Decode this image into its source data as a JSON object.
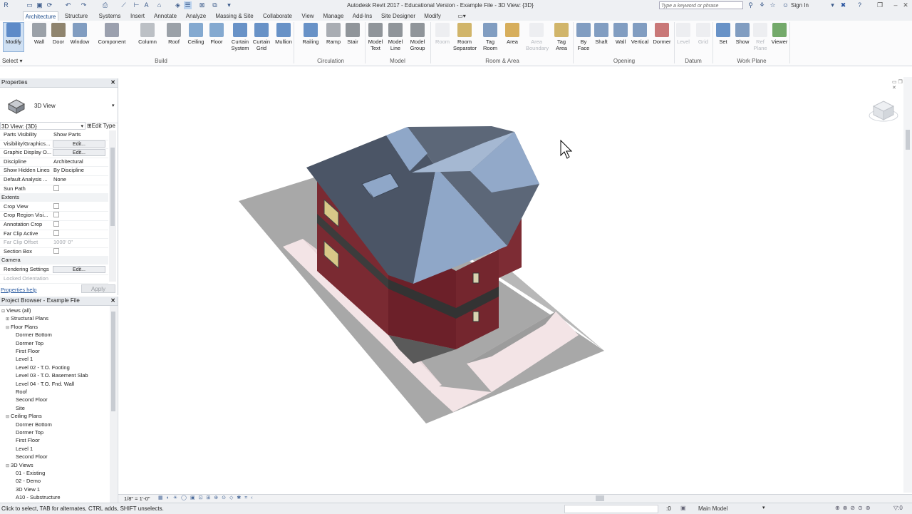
{
  "app": {
    "title": "Autodesk Revit 2017 - Educational Version -    Example File - 3D View: {3D}",
    "search_placeholder": "Type a keyword or phrase",
    "sign_in": "Sign In"
  },
  "tabs": [
    "Architecture",
    "Structure",
    "Systems",
    "Insert",
    "Annotate",
    "Analyze",
    "Massing & Site",
    "Collaborate",
    "View",
    "Manage",
    "Add-Ins",
    "Site Designer",
    "Modify"
  ],
  "ribbon": {
    "select_label": "Select",
    "buttons": [
      {
        "l1": "Modify",
        "l2": ""
      },
      {
        "l1": "Wall",
        "l2": ""
      },
      {
        "l1": "Door",
        "l2": ""
      },
      {
        "l1": "Window",
        "l2": ""
      },
      {
        "l1": "Component",
        "l2": ""
      },
      {
        "l1": "Column",
        "l2": ""
      },
      {
        "l1": "Roof",
        "l2": ""
      },
      {
        "l1": "Ceiling",
        "l2": ""
      },
      {
        "l1": "Floor",
        "l2": ""
      },
      {
        "l1": "Curtain",
        "l2": "System"
      },
      {
        "l1": "Curtain",
        "l2": "Grid"
      },
      {
        "l1": "Mullion",
        "l2": ""
      },
      {
        "l1": "Railing",
        "l2": ""
      },
      {
        "l1": "Ramp",
        "l2": ""
      },
      {
        "l1": "Stair",
        "l2": ""
      },
      {
        "l1": "Model",
        "l2": "Text"
      },
      {
        "l1": "Model",
        "l2": "Line"
      },
      {
        "l1": "Model",
        "l2": "Group"
      },
      {
        "l1": "Room",
        "l2": ""
      },
      {
        "l1": "Room",
        "l2": "Separator"
      },
      {
        "l1": "Tag",
        "l2": "Room"
      },
      {
        "l1": "Area",
        "l2": ""
      },
      {
        "l1": "Area",
        "l2": "Boundary"
      },
      {
        "l1": "Tag",
        "l2": "Area"
      },
      {
        "l1": "By",
        "l2": "Face"
      },
      {
        "l1": "Shaft",
        "l2": ""
      },
      {
        "l1": "Wall",
        "l2": ""
      },
      {
        "l1": "Vertical",
        "l2": ""
      },
      {
        "l1": "Dormer",
        "l2": ""
      },
      {
        "l1": "Level",
        "l2": ""
      },
      {
        "l1": "Grid",
        "l2": ""
      },
      {
        "l1": "Set",
        "l2": ""
      },
      {
        "l1": "Show",
        "l2": ""
      },
      {
        "l1": "Ref",
        "l2": "Plane"
      },
      {
        "l1": "Viewer",
        "l2": ""
      }
    ],
    "panels": [
      "Build",
      "Circulation",
      "Model",
      "Room & Area",
      "Opening",
      "Datum",
      "Work Plane"
    ]
  },
  "properties": {
    "title": "Properties",
    "type_name": "3D View",
    "instance_selector": "3D View: {3D}",
    "edit_type": "Edit Type",
    "rows_graphics": [
      {
        "k": "Parts Visibility",
        "v": "Show Parts",
        "kind": "text"
      },
      {
        "k": "Visibility/Graphics...",
        "v": "Edit...",
        "kind": "btn"
      },
      {
        "k": "Graphic Display O...",
        "v": "Edit...",
        "kind": "btn"
      },
      {
        "k": "Discipline",
        "v": "Architectural",
        "kind": "text"
      },
      {
        "k": "Show Hidden Lines",
        "v": "By Discipline",
        "kind": "text"
      },
      {
        "k": "Default Analysis ...",
        "v": "None",
        "kind": "text"
      },
      {
        "k": "Sun Path",
        "v": "",
        "kind": "cb"
      }
    ],
    "group_extents": "Extents",
    "rows_extents": [
      {
        "k": "Crop View",
        "v": "",
        "kind": "cb"
      },
      {
        "k": "Crop Region Visi...",
        "v": "",
        "kind": "cb"
      },
      {
        "k": "Annotation Crop",
        "v": "",
        "kind": "cb"
      },
      {
        "k": "Far Clip Active",
        "v": "",
        "kind": "cb"
      },
      {
        "k": "Far Clip Offset",
        "v": "1000'  0\"",
        "kind": "dis"
      },
      {
        "k": "Section Box",
        "v": "",
        "kind": "cb"
      }
    ],
    "group_camera": "Camera",
    "rows_camera": [
      {
        "k": "Rendering Settings",
        "v": "Edit...",
        "kind": "btn"
      },
      {
        "k": "Locked Orientation",
        "v": "",
        "kind": "dis"
      }
    ],
    "help_link": "Properties help",
    "apply": "Apply"
  },
  "browser": {
    "title": "Project Browser - Example File",
    "items": [
      {
        "t": "Views (all)",
        "lvl": 0,
        "tg": "⊟"
      },
      {
        "t": "Structural Plans",
        "lvl": 1,
        "tg": "⊞"
      },
      {
        "t": "Floor Plans",
        "lvl": 1,
        "tg": "⊟"
      },
      {
        "t": "Dormer Bottom",
        "lvl": 2,
        "tg": ""
      },
      {
        "t": "Dormer Top",
        "lvl": 2,
        "tg": ""
      },
      {
        "t": "First Floor",
        "lvl": 2,
        "tg": ""
      },
      {
        "t": "Level 1",
        "lvl": 2,
        "tg": ""
      },
      {
        "t": "Level 02 - T.O. Footing",
        "lvl": 2,
        "tg": ""
      },
      {
        "t": "Level 03 - T.O. Basement Slab",
        "lvl": 2,
        "tg": ""
      },
      {
        "t": "Level 04 - T.O. Fnd. Wall",
        "lvl": 2,
        "tg": ""
      },
      {
        "t": "Roof",
        "lvl": 2,
        "tg": ""
      },
      {
        "t": "Second Floor",
        "lvl": 2,
        "tg": ""
      },
      {
        "t": "Site",
        "lvl": 2,
        "tg": ""
      },
      {
        "t": "Ceiling Plans",
        "lvl": 1,
        "tg": "⊟"
      },
      {
        "t": "Dormer Bottom",
        "lvl": 2,
        "tg": ""
      },
      {
        "t": "Dormer Top",
        "lvl": 2,
        "tg": ""
      },
      {
        "t": "First Floor",
        "lvl": 2,
        "tg": ""
      },
      {
        "t": "Level 1",
        "lvl": 2,
        "tg": ""
      },
      {
        "t": "Second Floor",
        "lvl": 2,
        "tg": ""
      },
      {
        "t": "3D Views",
        "lvl": 1,
        "tg": "⊟"
      },
      {
        "t": "01 - Existing",
        "lvl": 2,
        "tg": ""
      },
      {
        "t": "02 - Demo",
        "lvl": 2,
        "tg": ""
      },
      {
        "t": "3D View 1",
        "lvl": 2,
        "tg": ""
      },
      {
        "t": "A10 - Substructure",
        "lvl": 2,
        "tg": ""
      }
    ]
  },
  "viewbar": {
    "scale": "1/8\" = 1'-0\""
  },
  "status": {
    "message": "Click to select, TAB for alternates, CTRL adds, SHIFT unselects.",
    "counter": ":0",
    "model": "Main Model"
  },
  "colors": {
    "accent": "#1a4a8a",
    "roof": "#4b5566",
    "roof_light": "#8fa7c8",
    "brick": "#7a2a32",
    "site": "#9a9a9a",
    "path": "#f3e4e6"
  }
}
